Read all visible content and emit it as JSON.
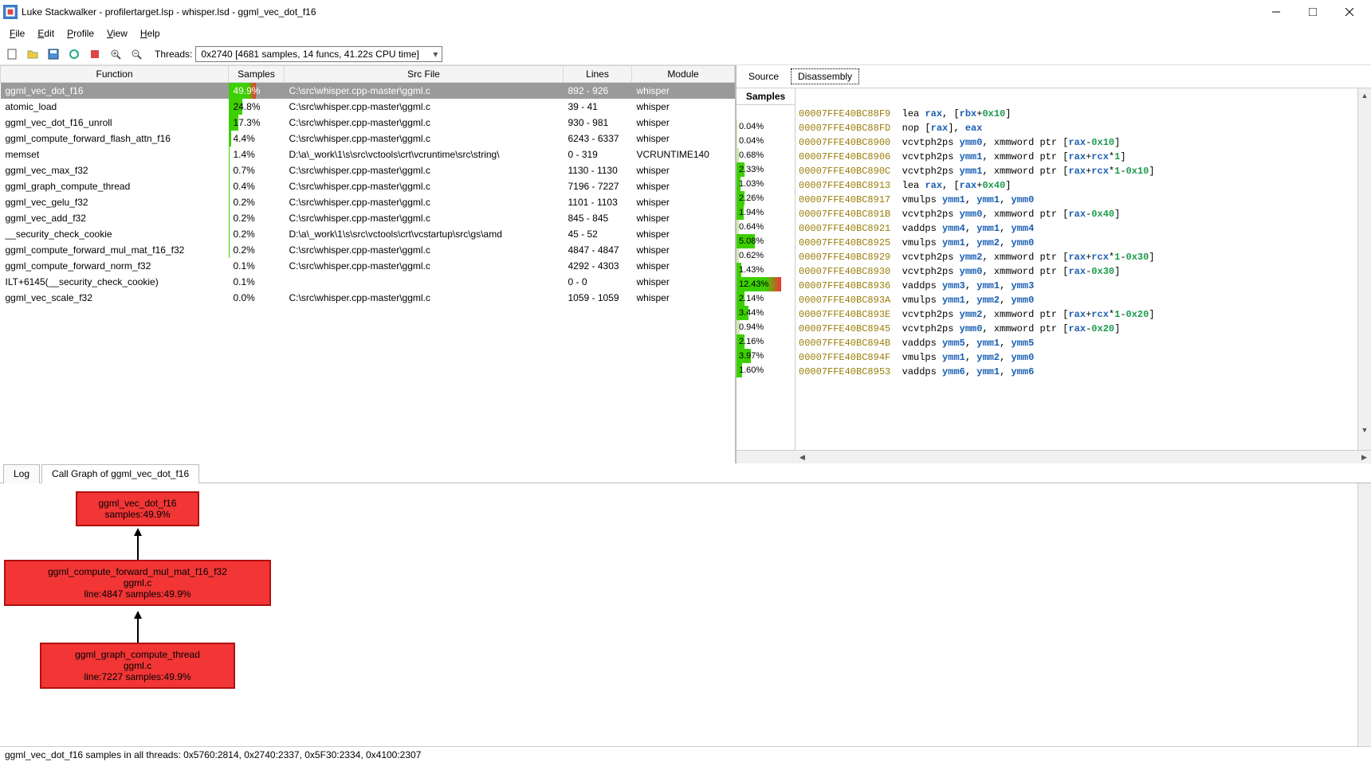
{
  "window": {
    "title": "Luke Stackwalker - profilertarget.lsp - whisper.lsd - ggml_vec_dot_f16"
  },
  "menu": [
    "File",
    "Edit",
    "Profile",
    "View",
    "Help"
  ],
  "toolbar": {
    "threads_label": "Threads:",
    "threads_value": "0x2740 [4681 samples, 14 funcs, 41.22s CPU time]"
  },
  "columns": [
    "Function",
    "Samples",
    "Src File",
    "Lines",
    "Module"
  ],
  "func_rows": [
    {
      "fn": "ggml_vec_dot_f16",
      "pct": "49.9%",
      "bar": 49.9,
      "color": "#3cd000",
      "grad": true,
      "src": "C:\\src\\whisper.cpp-master\\ggml.c",
      "ln": "892 - 926",
      "mod": "whisper",
      "sel": true
    },
    {
      "fn": "atomic_load",
      "pct": "24.8%",
      "bar": 24.8,
      "color": "#3cd000",
      "src": "C:\\src\\whisper.cpp-master\\ggml.c",
      "ln": "39 - 41",
      "mod": "whisper"
    },
    {
      "fn": "ggml_vec_dot_f16_unroll",
      "pct": "17.3%",
      "bar": 17.3,
      "color": "#3cd000",
      "src": "C:\\src\\whisper.cpp-master\\ggml.c",
      "ln": "930 - 981",
      "mod": "whisper"
    },
    {
      "fn": "ggml_compute_forward_flash_attn_f16",
      "pct": "4.4%",
      "bar": 4.4,
      "color": "#3cd000",
      "src": "C:\\src\\whisper.cpp-master\\ggml.c",
      "ln": "6243 - 6337",
      "mod": "whisper"
    },
    {
      "fn": "memset",
      "pct": "1.4%",
      "bar": 1.4,
      "color": "#3cd000",
      "src": "D:\\a\\_work\\1\\s\\src\\vctools\\crt\\vcruntime\\src\\string\\",
      "ln": "0 - 319",
      "mod": "VCRUNTIME140"
    },
    {
      "fn": "ggml_vec_max_f32",
      "pct": "0.7%",
      "bar": 0.7,
      "color": "#3cd000",
      "src": "C:\\src\\whisper.cpp-master\\ggml.c",
      "ln": "1130 - 1130",
      "mod": "whisper"
    },
    {
      "fn": "ggml_graph_compute_thread",
      "pct": "0.4%",
      "bar": 0.4,
      "color": "#3cd000",
      "src": "C:\\src\\whisper.cpp-master\\ggml.c",
      "ln": "7196 - 7227",
      "mod": "whisper"
    },
    {
      "fn": "ggml_vec_gelu_f32",
      "pct": "0.2%",
      "bar": 0.2,
      "color": "#3cd000",
      "src": "C:\\src\\whisper.cpp-master\\ggml.c",
      "ln": "1101 - 1103",
      "mod": "whisper"
    },
    {
      "fn": "ggml_vec_add_f32",
      "pct": "0.2%",
      "bar": 0.2,
      "color": "#3cd000",
      "src": "C:\\src\\whisper.cpp-master\\ggml.c",
      "ln": "845 - 845",
      "mod": "whisper"
    },
    {
      "fn": "__security_check_cookie",
      "pct": "0.2%",
      "bar": 0.2,
      "color": "#3cd000",
      "src": "D:\\a\\_work\\1\\s\\src\\vctools\\crt\\vcstartup\\src\\gs\\amd",
      "ln": "45 - 52",
      "mod": "whisper"
    },
    {
      "fn": "ggml_compute_forward_mul_mat_f16_f32",
      "pct": "0.2%",
      "bar": 0.2,
      "color": "#3cd000",
      "src": "C:\\src\\whisper.cpp-master\\ggml.c",
      "ln": "4847 - 4847",
      "mod": "whisper"
    },
    {
      "fn": "ggml_compute_forward_norm_f32",
      "pct": "0.1%",
      "bar": 0.1,
      "color": "#3cd000",
      "src": "C:\\src\\whisper.cpp-master\\ggml.c",
      "ln": "4292 - 4303",
      "mod": "whisper"
    },
    {
      "fn": "ILT+6145(__security_check_cookie)",
      "pct": "0.1%",
      "bar": 0.1,
      "color": "#3cd000",
      "src": "",
      "ln": "0 - 0",
      "mod": "whisper"
    },
    {
      "fn": "ggml_vec_scale_f32",
      "pct": "0.0%",
      "bar": 0.0,
      "color": "#3cd000",
      "src": "C:\\src\\whisper.cpp-master\\ggml.c",
      "ln": "1059 - 1059",
      "mod": "whisper"
    }
  ],
  "src_tabs": {
    "source": "Source",
    "disasm": "Disassembly"
  },
  "samples_hdr": "Samples",
  "asm_rows": [
    {
      "pct": "",
      "bar": 0,
      "addr": "00007FFE40BC88F9",
      "code": "lea <r>rax</r>, [<r>rbx</r>+<n>0x10</n>]"
    },
    {
      "pct": "0.04%",
      "bar": 0.04,
      "addr": "00007FFE40BC88FD",
      "code": "nop [<r>rax</r>], <r>eax</r>"
    },
    {
      "pct": "0.04%",
      "bar": 0.04,
      "addr": "00007FFE40BC8900",
      "code": "vcvtph2ps <r>ymm0</r>, xmmword ptr [<r>rax</r>-<n>0x10</n>]"
    },
    {
      "pct": "0.68%",
      "bar": 0.68,
      "addr": "00007FFE40BC8906",
      "code": "vcvtph2ps <r>ymm1</r>, xmmword ptr [<r>rax</r>+<r>rcx</r>*<n>1</n>]"
    },
    {
      "pct": "2.33%",
      "bar": 2.33,
      "color": "#3cd000",
      "addr": "00007FFE40BC890C",
      "code": "vcvtph2ps <r>ymm1</r>, xmmword ptr [<r>rax</r>+<r>rcx</r>*<n>1</n>-<n>0x10</n>]"
    },
    {
      "pct": "1.03%",
      "bar": 1.03,
      "color": "#3cd000",
      "addr": "00007FFE40BC8913",
      "code": "lea <r>rax</r>, [<r>rax</r>+<n>0x40</n>]"
    },
    {
      "pct": "2.26%",
      "bar": 2.26,
      "color": "#3cd000",
      "addr": "00007FFE40BC8917",
      "code": "vmulps <r>ymm1</r>, <r>ymm1</r>, <r>ymm0</r>"
    },
    {
      "pct": "1.94%",
      "bar": 1.94,
      "color": "#3cd000",
      "addr": "00007FFE40BC891B",
      "code": "vcvtph2ps <r>ymm0</r>, xmmword ptr [<r>rax</r>-<n>0x40</n>]"
    },
    {
      "pct": "0.64%",
      "bar": 0.64,
      "addr": "00007FFE40BC8921",
      "code": "vaddps <r>ymm4</r>, <r>ymm1</r>, <r>ymm4</r>"
    },
    {
      "pct": "5.08%",
      "bar": 5.08,
      "color": "#3cd000",
      "addr": "00007FFE40BC8925",
      "code": "vmulps <r>ymm1</r>, <r>ymm2</r>, <r>ymm0</r>"
    },
    {
      "pct": "0.62%",
      "bar": 0.62,
      "addr": "00007FFE40BC8929",
      "code": "vcvtph2ps <r>ymm2</r>, xmmword ptr [<r>rax</r>+<r>rcx</r>*<n>1</n>-<n>0x30</n>]"
    },
    {
      "pct": "1.43%",
      "bar": 1.43,
      "color": "#3cd000",
      "addr": "00007FFE40BC8930",
      "code": "vcvtph2ps <r>ymm0</r>, xmmword ptr [<r>rax</r>-<n>0x30</n>]"
    },
    {
      "pct": "12.43%",
      "bar": 12.43,
      "color": "#3cd000",
      "grad": true,
      "addr": "00007FFE40BC8936",
      "code": "vaddps <r>ymm3</r>, <r>ymm1</r>, <r>ymm3</r>"
    },
    {
      "pct": "2.14%",
      "bar": 2.14,
      "color": "#3cd000",
      "addr": "00007FFE40BC893A",
      "code": "vmulps <r>ymm1</r>, <r>ymm2</r>, <r>ymm0</r>"
    },
    {
      "pct": "3.44%",
      "bar": 3.44,
      "color": "#3cd000",
      "addr": "00007FFE40BC893E",
      "code": "vcvtph2ps <r>ymm2</r>, xmmword ptr [<r>rax</r>+<r>rcx</r>*<n>1</n>-<n>0x20</n>]"
    },
    {
      "pct": "0.94%",
      "bar": 0.94,
      "addr": "00007FFE40BC8945",
      "code": "vcvtph2ps <r>ymm0</r>, xmmword ptr [<r>rax</r>-<n>0x20</n>]"
    },
    {
      "pct": "2.16%",
      "bar": 2.16,
      "color": "#3cd000",
      "addr": "00007FFE40BC894B",
      "code": "vaddps <r>ymm5</r>, <r>ymm1</r>, <r>ymm5</r>"
    },
    {
      "pct": "3.97%",
      "bar": 3.97,
      "color": "#3cd000",
      "addr": "00007FFE40BC894F",
      "code": "vmulps <r>ymm1</r>, <r>ymm2</r>, <r>ymm0</r>"
    },
    {
      "pct": "1.60%",
      "bar": 1.6,
      "color": "#3cd000",
      "addr": "00007FFE40BC8953",
      "code": "vaddps <r>ymm6</r>, <r>ymm1</r>, <r>ymm6</r>"
    }
  ],
  "bottom_tabs": {
    "log": "Log",
    "graph": "Call Graph of ggml_vec_dot_f16"
  },
  "graph": {
    "n1": {
      "l1": "ggml_vec_dot_f16",
      "l2": "samples:49.9%"
    },
    "n2": {
      "l1": "ggml_compute_forward_mul_mat_f16_f32",
      "l2": "ggml.c",
      "l3": "line:4847 samples:49.9%"
    },
    "n3": {
      "l1": "ggml_graph_compute_thread",
      "l2": "ggml.c",
      "l3": "line:7227 samples:49.9%"
    }
  },
  "status": "ggml_vec_dot_f16 samples in all threads: 0x5760:2814, 0x2740:2337, 0x5F30:2334, 0x4100:2307"
}
